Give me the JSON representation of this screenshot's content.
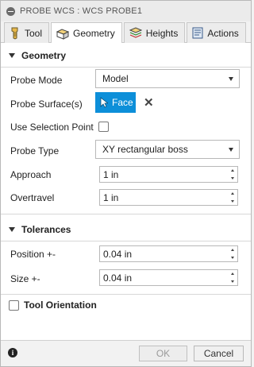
{
  "window": {
    "title": "PROBE WCS : WCS PROBE1"
  },
  "tabs": [
    {
      "label": "Tool",
      "icon": "tool-icon"
    },
    {
      "label": "Geometry",
      "icon": "geometry-icon",
      "active": true
    },
    {
      "label": "Heights",
      "icon": "heights-icon"
    },
    {
      "label": "Actions",
      "icon": "actions-icon"
    }
  ],
  "geometry": {
    "header": "Geometry",
    "probe_mode": {
      "label": "Probe Mode",
      "value": "Model"
    },
    "probe_surfaces": {
      "label": "Probe Surface(s)",
      "selection": "Face"
    },
    "use_selection_point": {
      "label": "Use Selection Point",
      "checked": false
    },
    "probe_type": {
      "label": "Probe Type",
      "value": "XY rectangular boss"
    },
    "approach": {
      "label": "Approach",
      "value": "1 in"
    },
    "overtravel": {
      "label": "Overtravel",
      "value": "1 in"
    }
  },
  "tolerances": {
    "header": "Tolerances",
    "position": {
      "label": "Position +-",
      "value": "0.04 in"
    },
    "size": {
      "label": "Size +-",
      "value": "0.04 in"
    }
  },
  "tool_orientation": {
    "label": "Tool Orientation",
    "checked": false
  },
  "footer": {
    "ok_label": "OK",
    "cancel_label": "Cancel"
  },
  "colors": {
    "selection_blue": "#0d8fd9",
    "panel_bg": "#ffffff",
    "chrome_bg": "#f2f2f2"
  }
}
